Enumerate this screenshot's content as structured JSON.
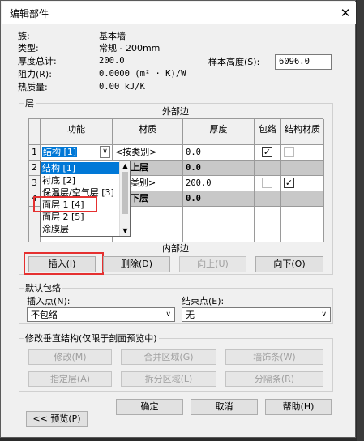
{
  "window": {
    "title": "编辑部件",
    "close_glyph": "✕"
  },
  "props": {
    "family_label": "族:",
    "family_value": "基本墙",
    "type_label": "类型:",
    "type_value": "常规 - 200mm",
    "thickness_label": "厚度总计:",
    "thickness_value": "200.0",
    "resistance_label": "阻力(R):",
    "resistance_value": "0.0000 (m² · K)/W",
    "thermal_label": "热质量:",
    "thermal_value": "0.00 kJ/K",
    "sample_height_label": "样本高度(S):",
    "sample_height_value": "6096.0"
  },
  "layers": {
    "group_label": "层",
    "exterior_label": "外部边",
    "interior_label": "内部边",
    "headers": {
      "function": "功能",
      "material": "材质",
      "thickness": "厚度",
      "wraps": "包络",
      "structural": "结构材质"
    },
    "rows": [
      {
        "num": "1",
        "function": "结构 [1]",
        "material": "<按类别>",
        "thickness": "0.0",
        "wraps": true,
        "structural": false
      },
      {
        "num": "2",
        "function": "",
        "material": "上层",
        "thickness": "0.0"
      },
      {
        "num": "3",
        "function": "",
        "material": "类别>",
        "thickness": "200.0",
        "wraps": false,
        "structural": true
      },
      {
        "num": "4",
        "function": "",
        "material": "下层",
        "thickness": "0.0"
      }
    ],
    "dropdown_options": [
      "结构 [1]",
      "衬底 [2]",
      "保温层/空气层 [3]",
      "面层 1 [4]",
      "面层 2 [5]",
      "涂膜层"
    ],
    "dropdown_arrow": "∨",
    "scroll_up": "▲",
    "scroll_down": "▼"
  },
  "layer_buttons": {
    "insert": "插入(I)",
    "delete": "删除(D)",
    "up": "向上(U)",
    "down": "向下(O)"
  },
  "default_wrap": {
    "group_label": "默认包络",
    "insert_label": "插入点(N):",
    "insert_value": "不包络",
    "end_label": "结束点(E):",
    "end_value": "无",
    "arrow": "∨"
  },
  "modify": {
    "group_label": "修改垂直结构(仅限于剖面预览中)",
    "modify_btn": "修改(M)",
    "merge_btn": "合并区域(G)",
    "sweep_btn": "墙饰条(W)",
    "assign_btn": "指定层(A)",
    "split_btn": "拆分区域(L)",
    "reveal_btn": "分隔条(R)"
  },
  "footer": {
    "ok": "确定",
    "cancel": "取消",
    "help": "帮助(H)",
    "preview": "<< 预览(P)"
  },
  "colors": {
    "highlight": "#0078d7",
    "red_box": "#e53030"
  }
}
